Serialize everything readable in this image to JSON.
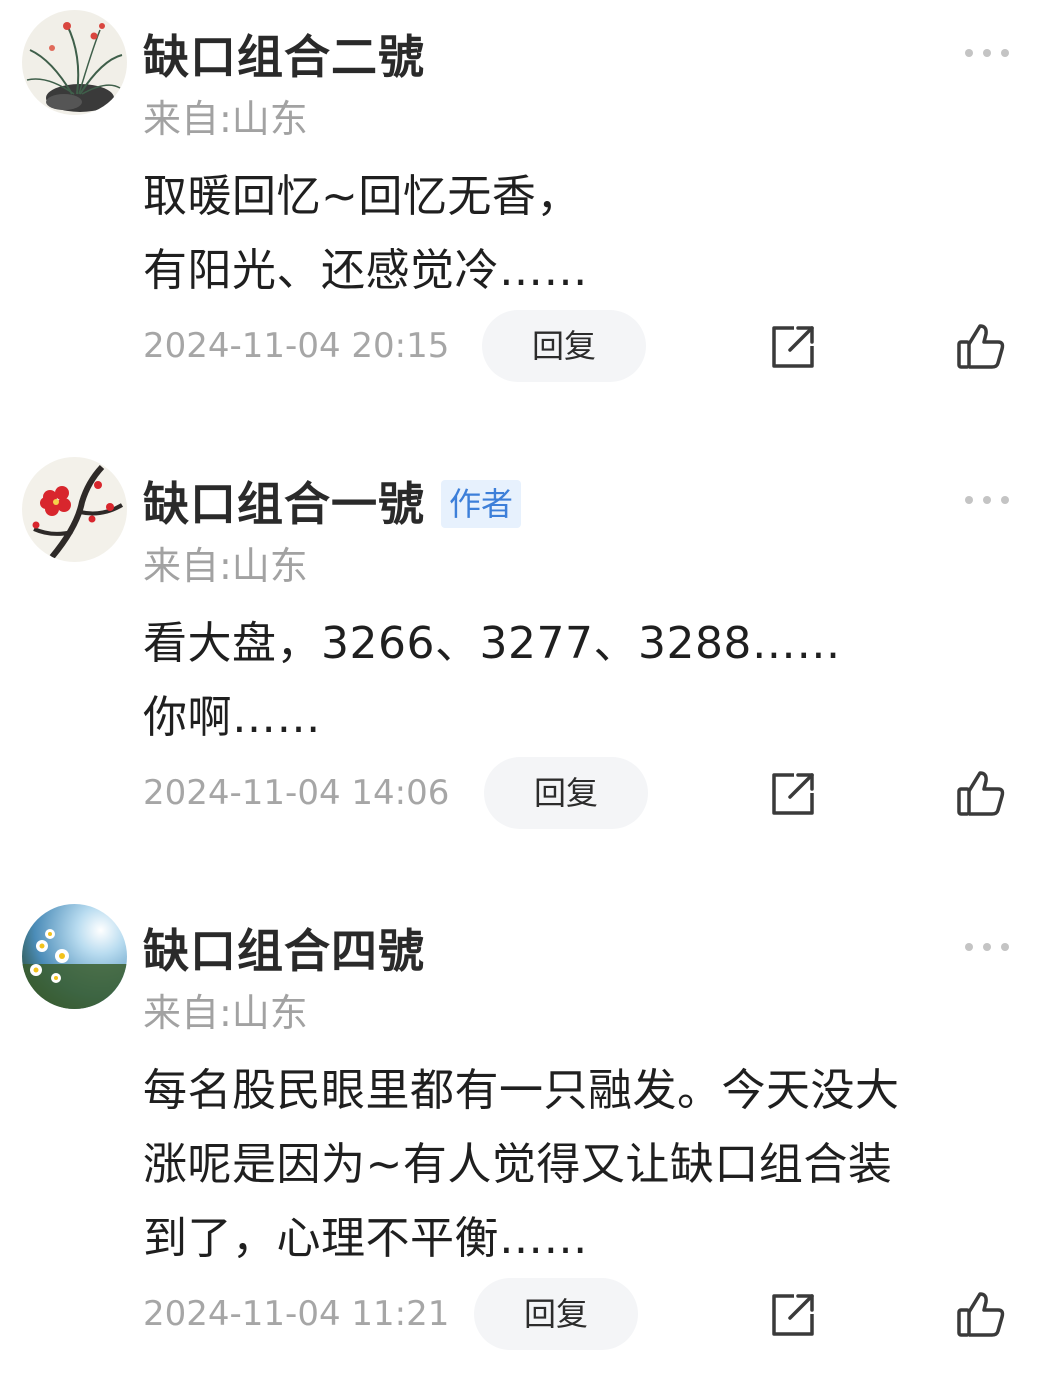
{
  "comments": [
    {
      "username": "缺口组合二號",
      "badge": "",
      "location": "来自:山东",
      "content": "取暖回忆~回忆无香，\n有阳光、还感觉冷……",
      "timestamp": "2024-11-04 20:15",
      "reply_label": "回复",
      "avatar": "orchid-painting"
    },
    {
      "username": "缺口组合一號",
      "badge": "作者",
      "location": "来自:山东",
      "content": "看大盘，3266、3277、3288……\n你啊……",
      "timestamp": "2024-11-04 14:06",
      "reply_label": "回复",
      "avatar": "plum-blossom-painting"
    },
    {
      "username": "缺口组合四號",
      "badge": "",
      "location": "来自:山东",
      "content": "每名股民眼里都有一只融发。今天没大\n涨呢是因为~有人觉得又让缺口组合装\n到了，心理不平衡……",
      "timestamp": "2024-11-04 11:21",
      "reply_label": "回复",
      "avatar": "daisy-photo"
    }
  ],
  "icons": {
    "more": "more-dots-icon",
    "share": "share-icon",
    "like": "thumbs-up-icon"
  },
  "colors": {
    "badge_bg": "#e7f1fd",
    "badge_text": "#3d7fd9",
    "meta_text": "#a2a2a2",
    "reply_bg": "#f4f5f7"
  }
}
